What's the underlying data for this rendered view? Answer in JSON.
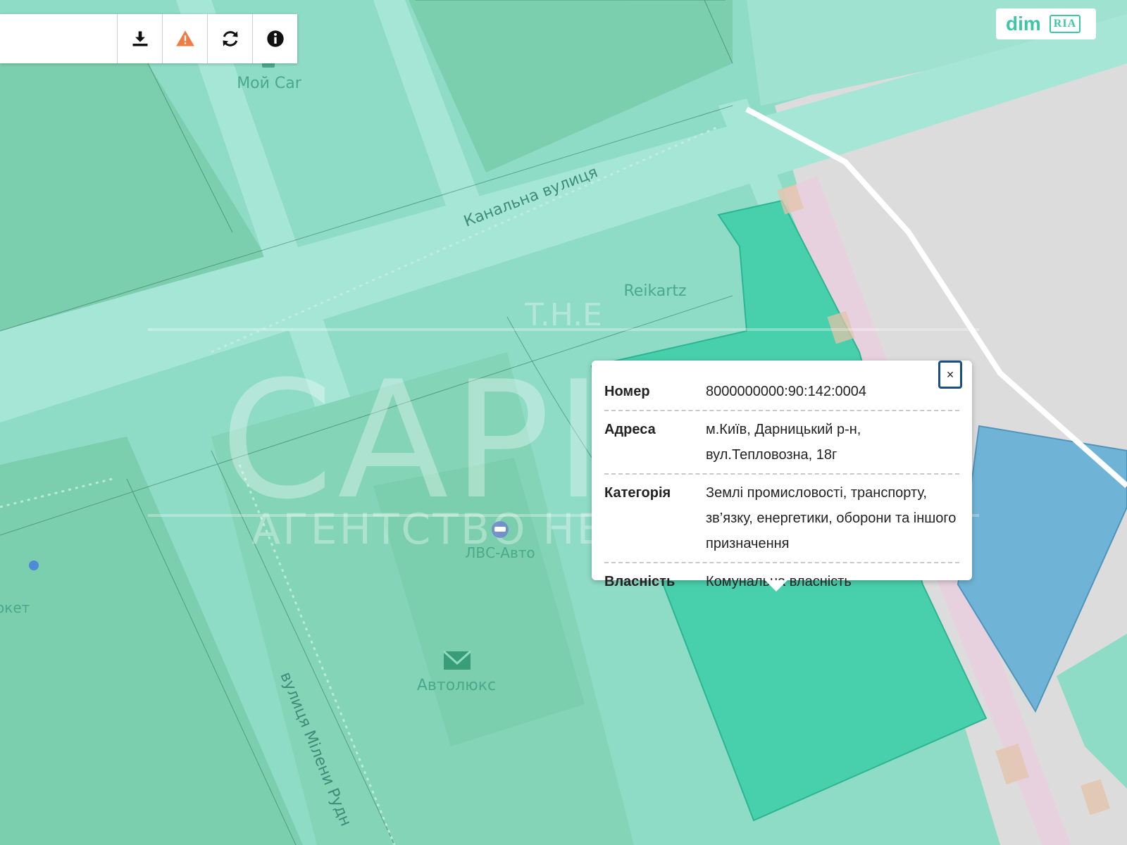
{
  "toolbar": {
    "buttons": [
      {
        "name": "download-button",
        "icon": "download-icon"
      },
      {
        "name": "report-button",
        "icon": "warning-icon"
      },
      {
        "name": "refresh-button",
        "icon": "refresh-icon"
      },
      {
        "name": "info-button",
        "icon": "info-icon"
      }
    ]
  },
  "brand": {
    "dim": "dim",
    "ria": "RIA"
  },
  "map": {
    "street_1": "Канальна вулиця",
    "street_2": "вулиця Мілени Рудн",
    "poi_moi_car": "Мой Car",
    "poi_reikartz": "Reikartz",
    "poi_lvs_auto": "ЛВС-Авто",
    "poi_avtolux": "Автолюкс",
    "poi_partial": "окет",
    "watermark_top": "T.H.E",
    "watermark_main": "CAPITAL",
    "watermark_sub": "АГЕНТСТВО НЕРУХОМОСТІ",
    "colors": {
      "base": "#8fdcc6",
      "parcel_dark": "#7ccfae",
      "road": "#a6e6d6",
      "selected_parcel": "#48cfac",
      "gray_area": "#dcdcdc",
      "blue_parcel": "#6fb3d6",
      "pink_strip": "#e7d1de"
    }
  },
  "popup": {
    "rows": [
      {
        "key": "Номер",
        "value": "8000000000:90:142:0004"
      },
      {
        "key": "Адреса",
        "value": "м.Київ, Дарницький р-н, вул.Тепловозна, 18г"
      },
      {
        "key": "Категорія",
        "value": "Землі промисловості, транспорту, зв’язку, енергетики, оборони та іншого призначення"
      },
      {
        "key": "Власність",
        "value": "Комунальна власність"
      }
    ],
    "close_label": "×"
  }
}
